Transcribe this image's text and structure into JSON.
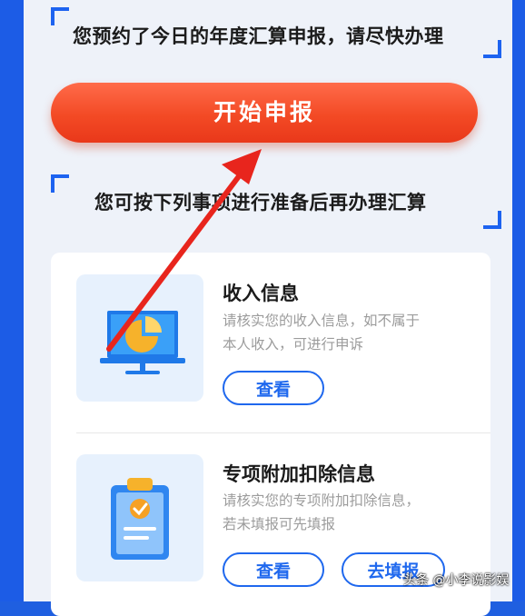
{
  "notice": {
    "text": "您预约了今日的年度汇算申报，请尽快办理"
  },
  "start_button": {
    "label": "开始申报"
  },
  "prep_text": "您可按下列事项进行准备后再办理汇算",
  "items": [
    {
      "title": "收入信息",
      "desc_line1": "请核实您的收入信息，如不属于",
      "desc_line2": "本人收入，可进行申诉",
      "view_label": "查看"
    },
    {
      "title": "专项附加扣除信息",
      "desc_line1": "请核实您的专项附加扣除信息，",
      "desc_line2": "若未填报可先填报",
      "view_label": "查看",
      "fill_label": "去填报"
    }
  ],
  "watermark": "头条 @小李说影娱",
  "colors": {
    "accent_blue": "#1f68ee",
    "cta_red": "#f34a25",
    "arrow_red": "#e8251d"
  }
}
